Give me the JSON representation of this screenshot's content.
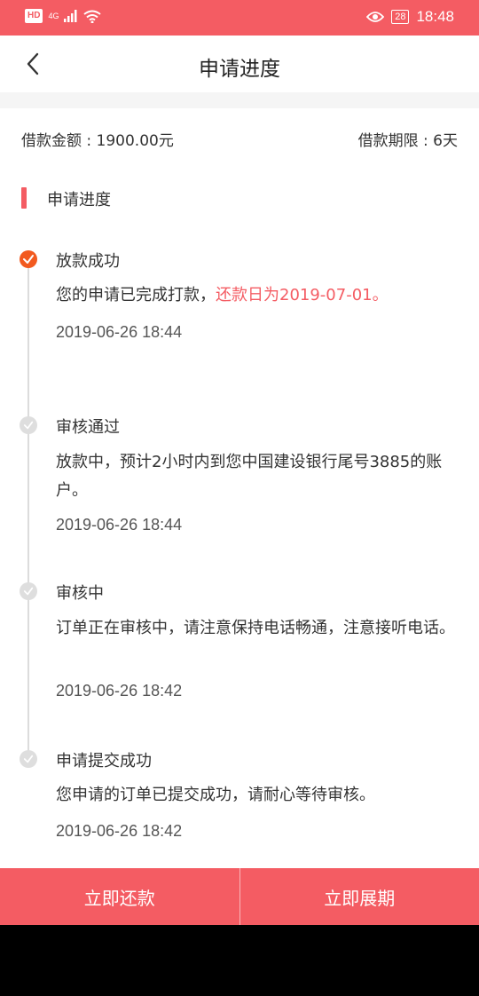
{
  "status_bar": {
    "hd": "HD",
    "network": "4G",
    "battery": "28",
    "time": "18:48",
    "icons": [
      "signal-icon",
      "wifi-icon",
      "eye-icon",
      "battery-icon"
    ]
  },
  "nav": {
    "title": "申请进度",
    "back_icon": "chevron-left-icon"
  },
  "summary": {
    "amount": "借款金额 : 1900.00元",
    "term": "借款期限 : 6天"
  },
  "section": {
    "title": "申请进度"
  },
  "steps": [
    {
      "title": "放款成功",
      "desc": "您的申请已完成打款，",
      "desc_highlight": "还款日为2019-07-01。",
      "time": "2019-06-26 18:44",
      "active": true
    },
    {
      "title": "审核通过",
      "desc": "放款中，预计2小时内到您中国建设银行尾号3885的账户。",
      "time": "2019-06-26 18:44",
      "active": false
    },
    {
      "title": "审核中",
      "desc": "订单正在审核中，请注意保持电话畅通，注意接听电话。",
      "time": "2019-06-26 18:42",
      "active": false
    },
    {
      "title": "申请提交成功",
      "desc": "您申请的订单已提交成功，请耐心等待审核。",
      "time": "2019-06-26 18:42",
      "active": false
    }
  ],
  "buttons": {
    "repay": "立即还款",
    "extend": "立即展期"
  },
  "colors": {
    "accent": "#f45c63",
    "active_dot": "#f25a1f",
    "inactive_dot": "#dedede"
  }
}
